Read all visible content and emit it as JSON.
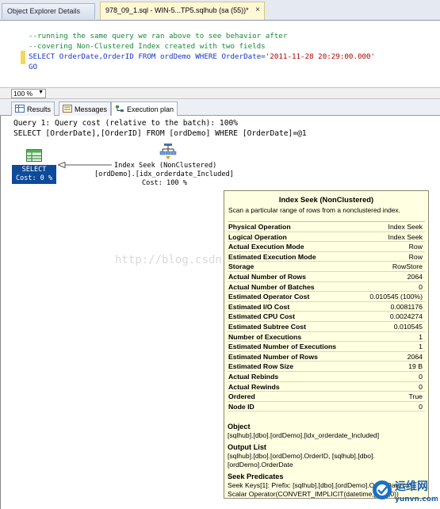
{
  "tabs": {
    "object_explorer": "Object Explorer Details",
    "query": "978_09_1.sql - WIN-5...TP5.sqlhub (sa (55))*",
    "close_glyph": "×"
  },
  "editor": {
    "line1": "--running the same query we ran above to see behavior after",
    "line2": "--covering Non-Clustered Index created with two fields",
    "line3_kw1": "SELECT",
    "line3_cols": " OrderDate,OrderID ",
    "line3_kw2": "FROM",
    "line3_tbl": " ordDemo ",
    "line3_kw3": "WHERE",
    "line3_col": " OrderDate=",
    "line3_str": "'2011-11-28 20:29:00.000'",
    "line4": "GO"
  },
  "zoom": {
    "value": "100 %",
    "arrow": "▼"
  },
  "results_tabs": [
    {
      "label": "Results"
    },
    {
      "label": "Messages"
    },
    {
      "label": "Execution plan"
    }
  ],
  "plan": {
    "query_cost": "Query 1: Query cost (relative to the batch): 100%",
    "query_sql": "SELECT [OrderDate],[OrderID] FROM [ordDemo] WHERE [OrderDate]=@1",
    "select_label": "SELECT",
    "select_cost": "Cost: 0 %",
    "seek_label": "Index Seek (NonClustered)",
    "seek_object": "[ordDemo].[idx_orderdate_Included]",
    "seek_cost": "Cost: 100 %"
  },
  "tooltip": {
    "title": "Index Seek (NonClustered)",
    "description": "Scan a particular range of rows from a nonclustered index.",
    "rows": [
      {
        "label": "Physical Operation",
        "value": "Index Seek"
      },
      {
        "label": "Logical Operation",
        "value": "Index Seek"
      },
      {
        "label": "Actual Execution Mode",
        "value": "Row"
      },
      {
        "label": "Estimated Execution Mode",
        "value": "Row"
      },
      {
        "label": "Storage",
        "value": "RowStore"
      },
      {
        "label": "Actual Number of Rows",
        "value": "2064"
      },
      {
        "label": "Actual Number of Batches",
        "value": "0"
      },
      {
        "label": "Estimated Operator Cost",
        "value": "0.010545 (100%)"
      },
      {
        "label": "Estimated I/O Cost",
        "value": "0.0081176"
      },
      {
        "label": "Estimated CPU Cost",
        "value": "0.0024274"
      },
      {
        "label": "Estimated Subtree Cost",
        "value": "0.010545"
      },
      {
        "label": "Number of Executions",
        "value": "1"
      },
      {
        "label": "Estimated Number of Executions",
        "value": "1"
      },
      {
        "label": "Estimated Number of Rows",
        "value": "2064"
      },
      {
        "label": "Estimated Row Size",
        "value": "19 B"
      },
      {
        "label": "Actual Rebinds",
        "value": "0"
      },
      {
        "label": "Actual Rewinds",
        "value": "0"
      },
      {
        "label": "Ordered",
        "value": "True"
      },
      {
        "label": "Node ID",
        "value": "0"
      }
    ],
    "object_heading": "Object",
    "object_value": "[sqlhub].[dbo].[ordDemo].[idx_orderdate_Included]",
    "output_heading": "Output List",
    "output_value": "[sqlhub].[dbo].[ordDemo].OrderID, [sqlhub].[dbo].[ordDemo].OrderDate",
    "seek_heading": "Seek Predicates",
    "seek_value": "Seek Keys[1]: Prefix: [sqlhub].[dbo].[ordDemo].OrderDate = Scalar Operator(CONVERT_IMPLICIT(datetime,[@1],0))"
  },
  "watermark": "http://blog.csdn.net/shiyiben",
  "logo_text": "运维网",
  "logo_sub": "yunvn.com",
  "colors": {
    "comment": "#1a8a3a",
    "keyword": "#1a35c8",
    "string": "#b00000",
    "select_node": "#0e4a9a",
    "tooltip_bg": "#ffffe1"
  }
}
